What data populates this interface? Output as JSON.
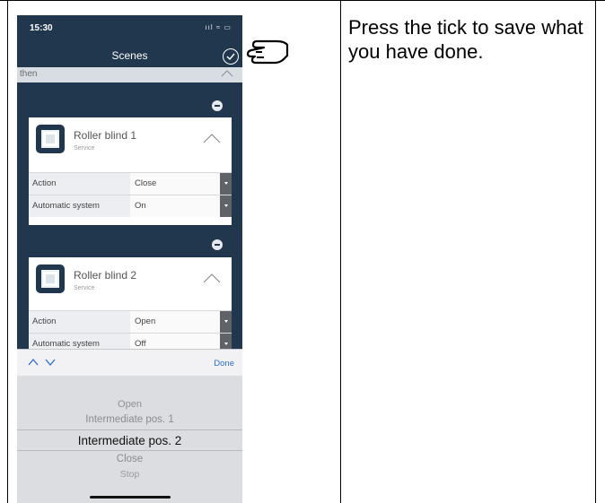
{
  "status_bar": {
    "time": "15:30",
    "indicators": "ııl ≈ ▭"
  },
  "header": {
    "title": "Scenes",
    "confirm_icon": "checkmark-circle-icon"
  },
  "section": {
    "label": "then"
  },
  "devices": [
    {
      "name": "Roller blind 1",
      "subtitle": "Service",
      "rows": [
        {
          "label": "Action",
          "value": "Close"
        },
        {
          "label": "Automatic system",
          "value": "On"
        }
      ]
    },
    {
      "name": "Roller blind 2",
      "subtitle": "Service",
      "rows": [
        {
          "label": "Action",
          "value": "Open"
        },
        {
          "label": "Automatic system",
          "value": "Off"
        }
      ]
    }
  ],
  "keyboard_toolbar": {
    "done_label": "Done"
  },
  "picker": {
    "options": [
      "Open",
      "Intermediate pos. 1",
      "Intermediate pos. 2",
      "Close",
      "Stop"
    ],
    "selected": "Intermediate pos. 2"
  },
  "instruction": {
    "text": "Press the tick to save what you have done."
  },
  "colors": {
    "app_background": "#21374d",
    "accent": "#2a6fd1",
    "card": "#ffffff"
  }
}
